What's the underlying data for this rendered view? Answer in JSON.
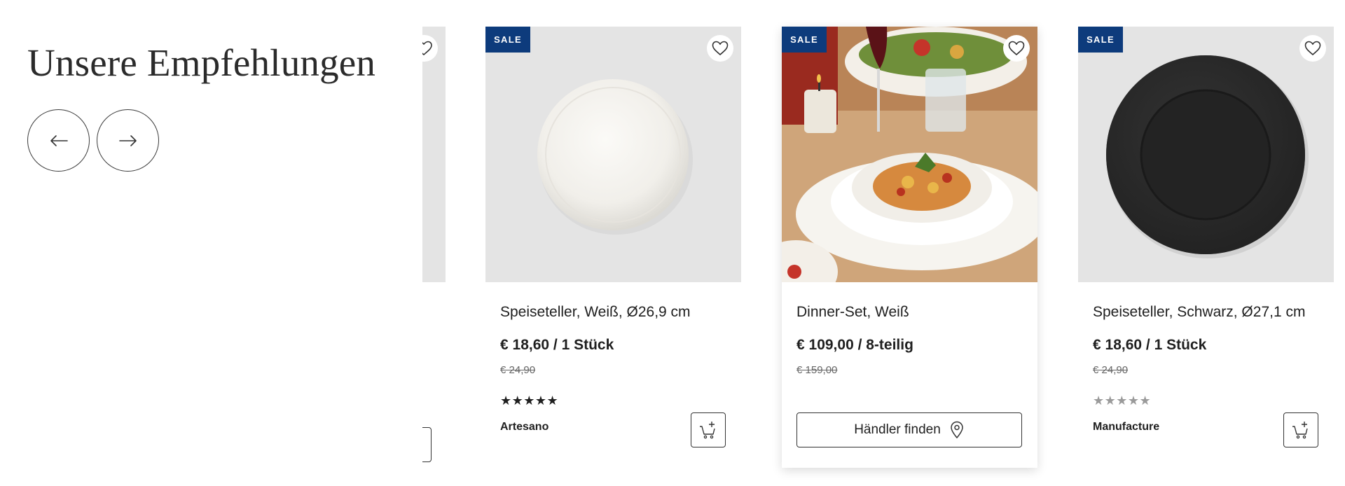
{
  "section": {
    "heading": "Unsere Empfehlungen",
    "prev_label": "previous-arrow",
    "next_label": "next-arrow"
  },
  "products": [
    {
      "badge": "SALE",
      "title": "Speiseteller, Weiß, Ø26,9 cm",
      "price": "€ 18,60 / 1 Stück",
      "old_price": "€ 24,90",
      "stars": "★★★★★",
      "brand": "Artesano",
      "action": "add-to-cart"
    },
    {
      "badge": "SALE",
      "title": "Dinner-Set, Weiß",
      "price": "€ 109,00 / 8-teilig",
      "old_price": "€ 159,00",
      "action_label": "Händler finden"
    },
    {
      "badge": "SALE",
      "title": "Speiseteller, Schwarz, Ø27,1 cm",
      "price": "€ 18,60 / 1 Stück",
      "old_price": "€ 24,90",
      "stars": "★★★★★",
      "brand": "Manufacture",
      "action": "add-to-cart"
    }
  ],
  "colors": {
    "sale_badge": "#0d3b7c",
    "image_bg": "#e4e4e4",
    "text": "#1f1f1f",
    "stars_filled": "#1f1f1f",
    "stars_empty": "#9a9a9a"
  },
  "icons": [
    "arrow-left-icon",
    "arrow-right-icon",
    "heart-icon",
    "cart-plus-icon",
    "location-pin-icon"
  ]
}
